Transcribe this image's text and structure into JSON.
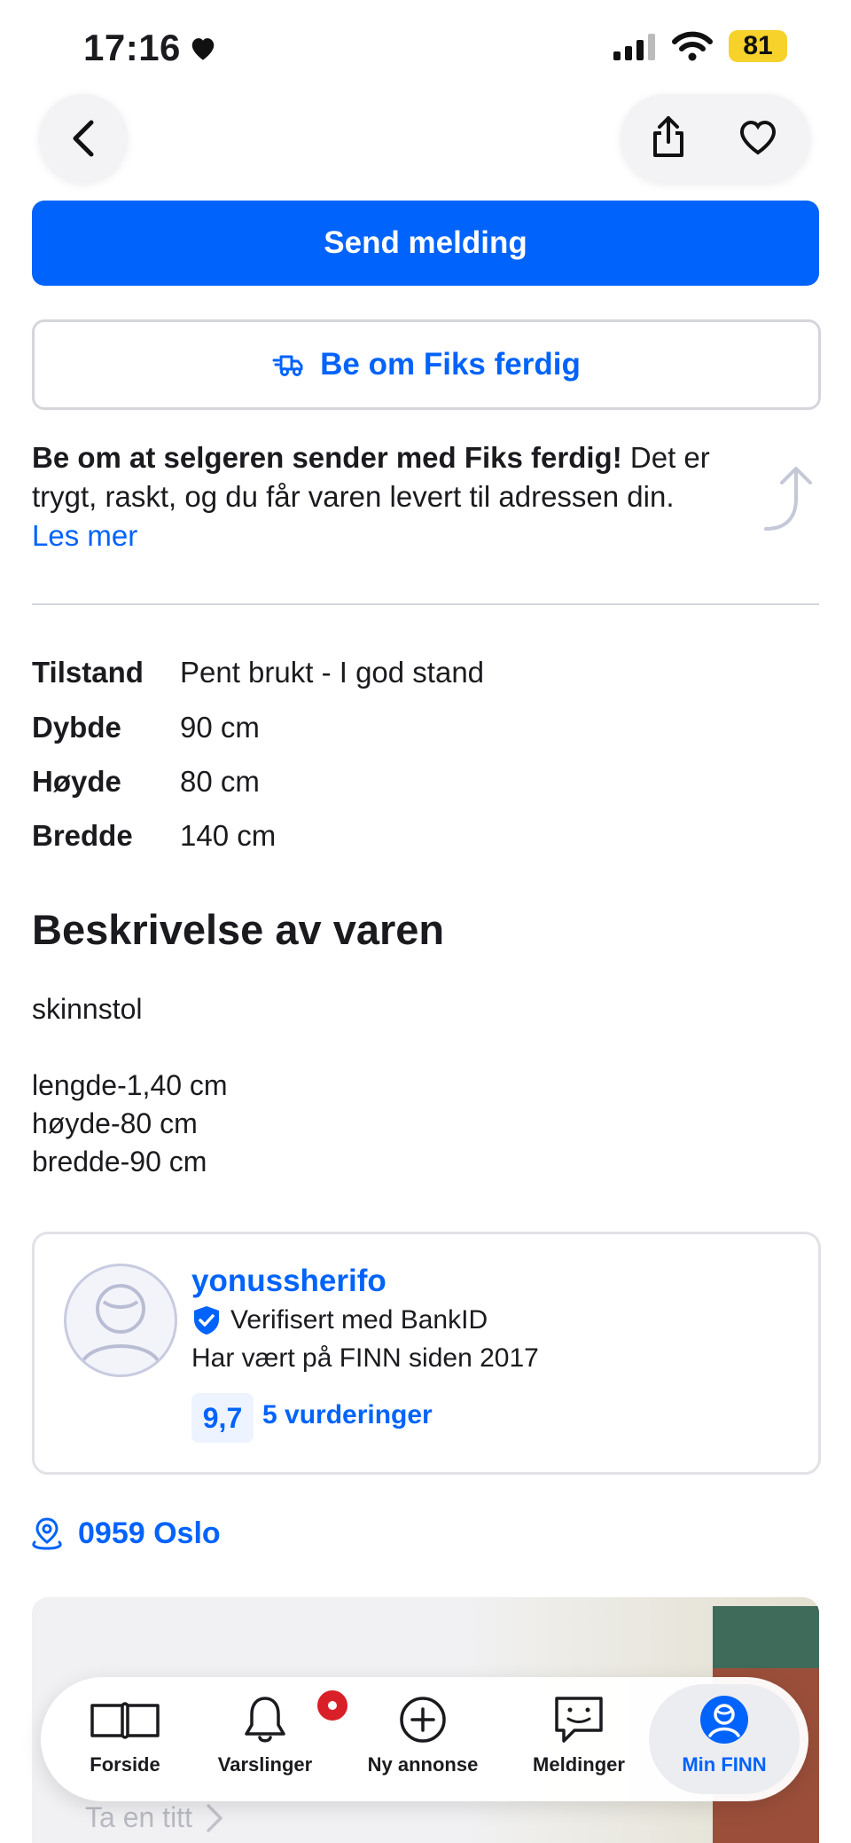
{
  "status_bar": {
    "time": "17:16",
    "battery": "81"
  },
  "actions": {
    "send_message": "Send melding",
    "fiks_ferdig": "Be om Fiks ferdig"
  },
  "promo": {
    "bold": "Be om at selgeren sender med Fiks ferdig!",
    "text": " Det er trygt, raskt, og du får varen levert til adressen din.",
    "link": "Les mer"
  },
  "specs": [
    {
      "key": "Tilstand",
      "value": "Pent brukt - I god stand"
    },
    {
      "key": "Dybde",
      "value": "90 cm"
    },
    {
      "key": "Høyde",
      "value": "80 cm"
    },
    {
      "key": "Bredde",
      "value": "140 cm"
    }
  ],
  "description": {
    "heading": "Beskrivelse av varen",
    "body": "skinnstol\n\nlengde-1,40 cm\nhøyde-80 cm\nbredde-90 cm"
  },
  "seller": {
    "name": "yonussherifo",
    "verified": "Verifisert med BankID",
    "since": "Har vært på FINN siden 2017",
    "rating": "9,7",
    "reviews": "5 vurderinger"
  },
  "location": "0959 Oslo",
  "banner": {
    "cta": "Ta en titt"
  },
  "tabs": [
    {
      "label": "Forside",
      "icon": "book-icon"
    },
    {
      "label": "Varslinger",
      "icon": "bell-icon"
    },
    {
      "label": "Ny annonse",
      "icon": "plus-circle-icon"
    },
    {
      "label": "Meldinger",
      "icon": "chat-icon"
    },
    {
      "label": "Min FINN",
      "icon": "user-icon"
    }
  ],
  "colors": {
    "primary": "#0063fb",
    "badge": "#d91f27",
    "battery": "#f6d22b"
  }
}
